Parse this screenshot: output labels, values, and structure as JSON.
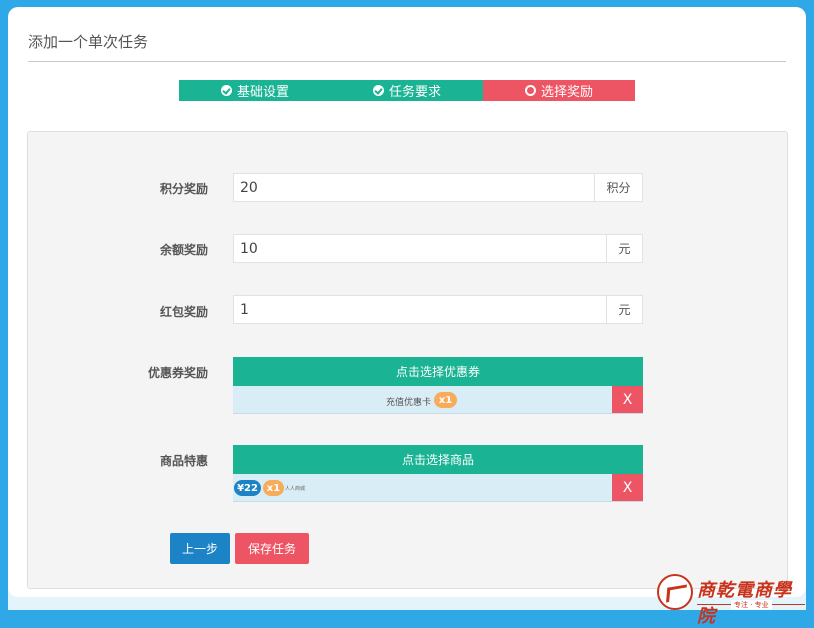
{
  "page": {
    "title": "添加一个单次任务"
  },
  "steps": [
    {
      "label": "基础设置",
      "state": "done"
    },
    {
      "label": "任务要求",
      "state": "done"
    },
    {
      "label": "选择奖励",
      "state": "active"
    }
  ],
  "form": {
    "points": {
      "label": "积分奖励",
      "value": "20",
      "unit": "积分"
    },
    "balance": {
      "label": "余额奖励",
      "value": "10",
      "unit": "元"
    },
    "redpacket": {
      "label": "红包奖励",
      "value": "1",
      "unit": "元"
    },
    "coupon": {
      "label": "优惠券奖励",
      "select_label": "点击选择优惠券",
      "item_name": "充值优惠卡",
      "item_qty": "x1",
      "remove_label": "X"
    },
    "goods": {
      "label": "商品特惠",
      "select_label": "点击选择商品",
      "item_price": "¥22",
      "item_qty": "x1",
      "item_name": "人人商城",
      "remove_label": "X"
    }
  },
  "buttons": {
    "prev": "上一步",
    "save": "保存任务"
  },
  "logo": {
    "name": "商乾電商學院",
    "tagline": "专注 · 专业"
  },
  "colors": {
    "green": "#1ab394",
    "red": "#ed5565",
    "blue": "#1c84c6",
    "orange": "#f8ac59",
    "frame": "#2fa8e8"
  }
}
